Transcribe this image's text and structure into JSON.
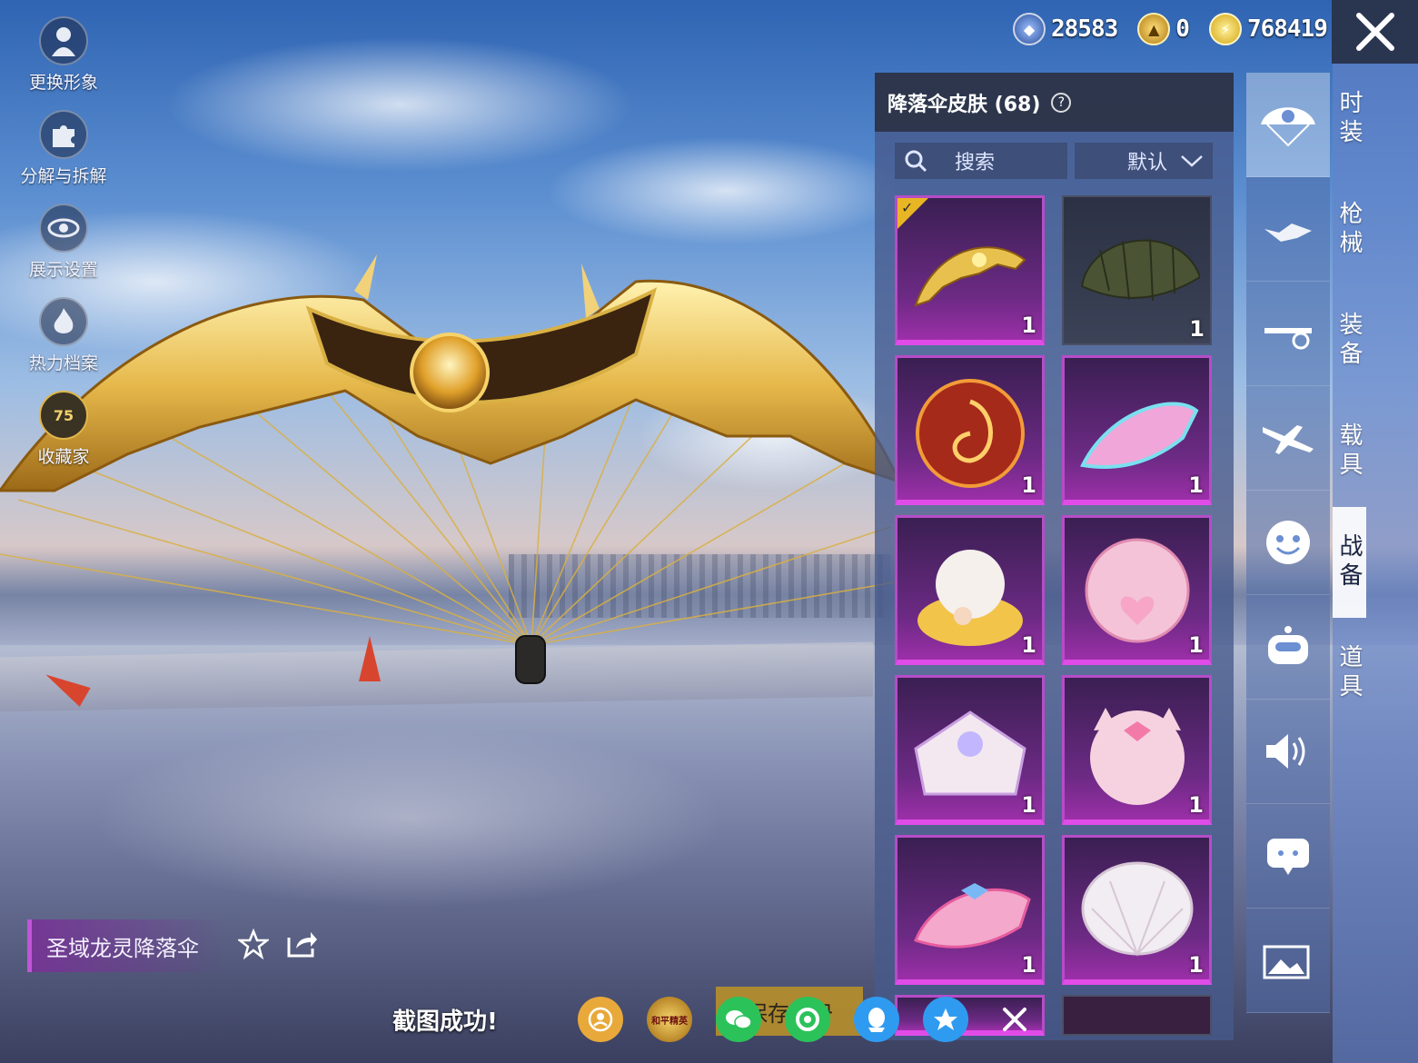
{
  "left_menu": [
    {
      "label": "更换形象",
      "icon": "avatar-icon"
    },
    {
      "label": "分解与拆解",
      "icon": "puzzle-icon"
    },
    {
      "label": "展示设置",
      "icon": "eye-icon"
    },
    {
      "label": "热力档案",
      "icon": "flame-icon"
    },
    {
      "label": "收藏家",
      "icon": "collector-badge-icon",
      "badge": "75"
    }
  ],
  "currencies": [
    {
      "value": "28583",
      "icon": "silver-coin-icon",
      "color": "#3a66b8"
    },
    {
      "value": "0",
      "icon": "gold-token-icon",
      "color": "#d6a523"
    },
    {
      "value": "768419",
      "icon": "lightning-coin-icon",
      "color": "#e8c22f"
    }
  ],
  "panel": {
    "title": "降落伞皮肤 (68)",
    "help": "?",
    "search_label": "搜索",
    "sort_label": "默认"
  },
  "items": [
    {
      "qty": "1",
      "selected": true,
      "style": "gold-wing"
    },
    {
      "qty": "1",
      "selected": false,
      "style": "olive-plain"
    },
    {
      "qty": "1",
      "selected": false,
      "style": "fire-swirl"
    },
    {
      "qty": "1",
      "selected": false,
      "style": "pink-cyan"
    },
    {
      "qty": "1",
      "selected": false,
      "style": "cream-bun"
    },
    {
      "qty": "1",
      "selected": false,
      "style": "pink-heart"
    },
    {
      "qty": "1",
      "selected": false,
      "style": "lace-cream"
    },
    {
      "qty": "1",
      "selected": false,
      "style": "pink-cat"
    },
    {
      "qty": "1",
      "selected": false,
      "style": "pink-bow"
    },
    {
      "qty": "1",
      "selected": false,
      "style": "white-shell"
    }
  ],
  "category_icons": [
    "parachute-icon",
    "skydiver-icon",
    "drone-icon",
    "plane-icon",
    "emote-face-icon",
    "robot-icon",
    "speaker-icon",
    "chat-bubble-icon",
    "gallery-icon"
  ],
  "tabs": [
    "时装",
    "枪械",
    "装备",
    "载具",
    "战备",
    "道具"
  ],
  "active_tab": "战备",
  "item_name": "圣域龙灵降落伞",
  "toast": "截图成功!",
  "save_label": "保存相册",
  "share_icons": [
    "profile-share-icon",
    "game-logo-icon",
    "wechat-icon",
    "moments-icon",
    "qq-icon",
    "qzone-icon",
    "close-icon"
  ],
  "share_logo_text": "和平精英"
}
